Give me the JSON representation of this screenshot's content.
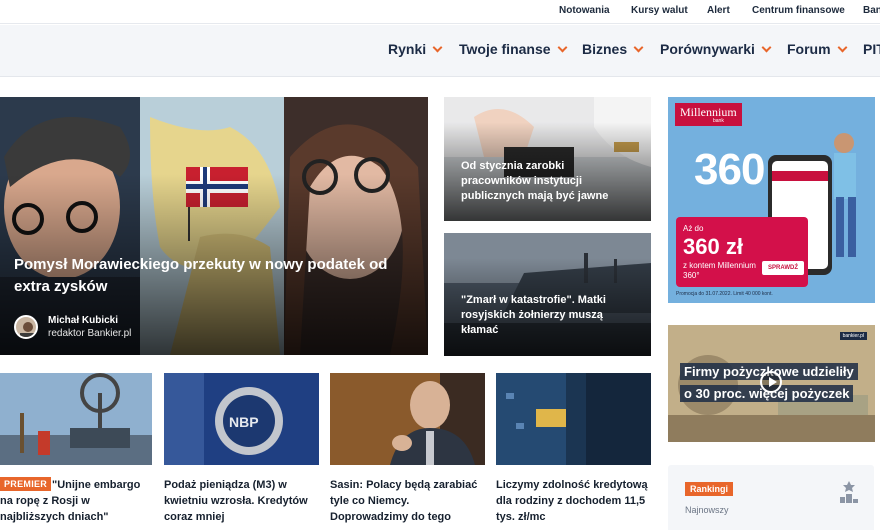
{
  "topbar": {
    "links": [
      "Notowania",
      "Kursy walut",
      "Alert",
      "Centrum finansowe",
      "Bankier.pl"
    ]
  },
  "nav": {
    "items": [
      "Rynki",
      "Twoje finanse",
      "Biznes",
      "Porównywarki",
      "Forum",
      "PIT"
    ],
    "chevron_icon": "chevron-down-icon",
    "accent_color": "#e8662b"
  },
  "hero": {
    "title": "Pomysł Morawieckiego przekuty w nowy podatek od extra zysków",
    "author_name": "Michał Kubicki",
    "author_role": "redaktor Bankier.pl"
  },
  "side_articles": [
    {
      "title": "Od stycznia zarobki pracowników instytucji publicznych mają być jawne"
    },
    {
      "title": "\"Zmarł w katastrofie\". Matki rosyjskich żołnierzy muszą kłamać"
    }
  ],
  "cards": [
    {
      "badge": "PREMIER",
      "title_lines": [
        "\"Unijne embargo",
        "na ropę z Rosji w",
        "najbliższych dniach\""
      ]
    },
    {
      "title_lines": [
        "Podaż pieniądza (M3) w",
        "kwietniu wzrosła. Kredytów",
        "coraz mniej"
      ]
    },
    {
      "title_lines": [
        "Sasin: Polacy będą zarabiać",
        "tyle co Niemcy.",
        "Doprowadzimy do tego"
      ]
    },
    {
      "title_lines": [
        "Liczymy zdolność kredytową",
        "dla rodziny z dochodem 11,5",
        "tys. zł/mc"
      ]
    }
  ],
  "ad": {
    "brand": "Millennium",
    "brand_sub": "bank",
    "big_number": "360",
    "small_label": "Aż do",
    "amount": "360 zł",
    "with_account": "z kontem Millennium 360°",
    "button": "SPRAWDŹ",
    "footer": "Promocja do 31.07.2022. Limit 40 000 kont."
  },
  "video": {
    "line1": "Firmy pożyczkowe udzieliły",
    "line2": "o 30 proc. więcej pożyczek",
    "tag": "bankier.pl"
  },
  "ranking": {
    "badge": "Rankingi",
    "subtitle": "Najnowszy"
  }
}
